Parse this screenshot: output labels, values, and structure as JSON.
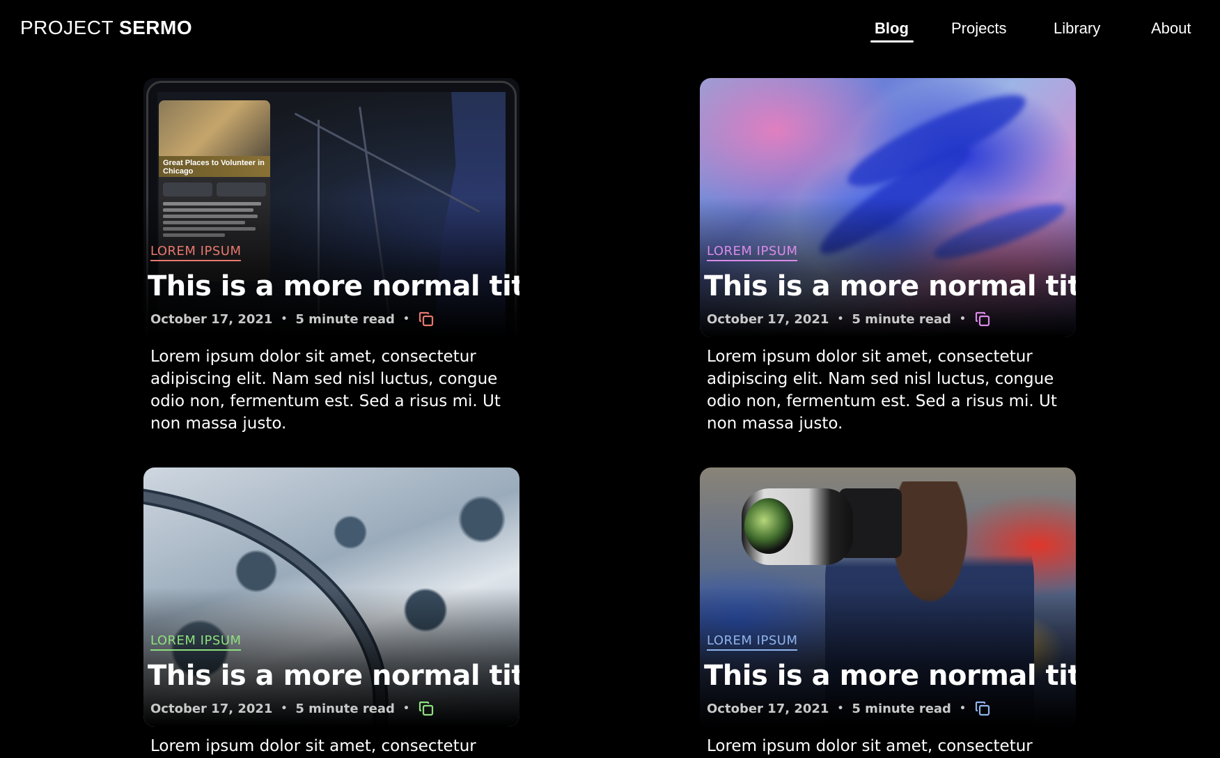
{
  "brand": {
    "light": "PROJECT",
    "bold": "SERMO"
  },
  "nav": {
    "items": [
      {
        "label": "Blog",
        "active": true
      },
      {
        "label": "Projects",
        "active": false
      },
      {
        "label": "Library",
        "active": false
      },
      {
        "label": "About",
        "active": false
      }
    ]
  },
  "posts": [
    {
      "tag": "LOREM IPSUM",
      "tag_color": "#e8786e",
      "title": "This is a more normal title",
      "date": "October 17, 2021",
      "read_time": "5 minute read",
      "excerpt": "Lorem ipsum dolor sit amet, consectetur adipiscing elit. Nam sed nisl luctus, congue odio non, fermentum est. Sed a risus mi. Ut non massa justo.",
      "image": {
        "caption": "Great Places to Volunteer in Chicago"
      }
    },
    {
      "tag": "LOREM IPSUM",
      "tag_color": "#d98be8",
      "title": "This is a more normal title",
      "date": "October 17, 2021",
      "read_time": "5 minute read",
      "excerpt": "Lorem ipsum dolor sit amet, consectetur adipiscing elit. Nam sed nisl luctus, congue odio non, fermentum est. Sed a risus mi. Ut non massa justo."
    },
    {
      "tag": "LOREM IPSUM",
      "tag_color": "#8ee07e",
      "title": "This is a more normal title",
      "date": "October 17, 2021",
      "read_time": "5 minute read",
      "excerpt": "Lorem ipsum dolor sit amet, consectetur"
    },
    {
      "tag": "LOREM IPSUM",
      "tag_color": "#8fb4ec",
      "title": "This is a more normal title",
      "date": "October 17, 2021",
      "read_time": "5 minute read",
      "excerpt": "Lorem ipsum dolor sit amet, consectetur"
    }
  ],
  "meta_separator": "•",
  "icons": {
    "copy": "copy-link-icon"
  }
}
